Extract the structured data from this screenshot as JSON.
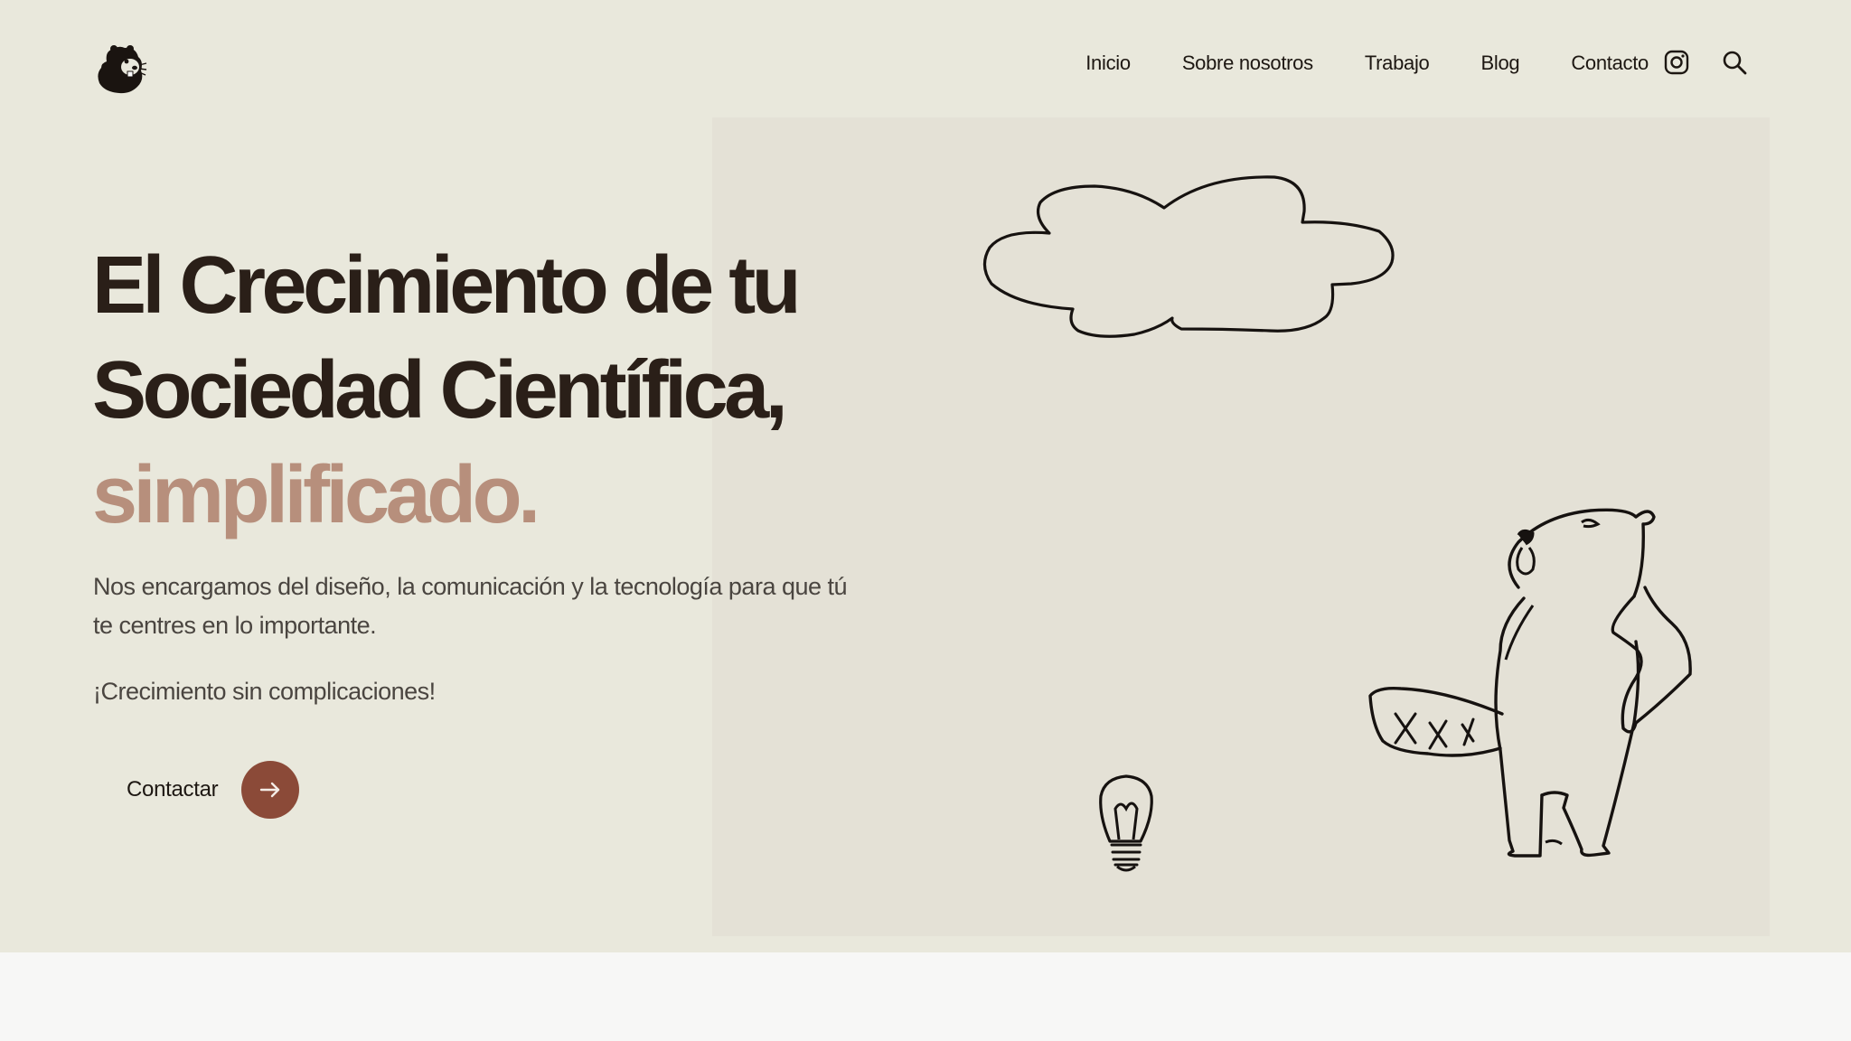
{
  "nav": {
    "items": [
      {
        "label": "Inicio"
      },
      {
        "label": "Sobre nosotros"
      },
      {
        "label": "Trabajo"
      },
      {
        "label": "Blog"
      },
      {
        "label": "Contacto"
      }
    ],
    "icons": [
      "instagram-icon",
      "search-icon"
    ]
  },
  "hero": {
    "headline_line1": "El Crecimiento de tu",
    "headline_line2": "Sociedad Científica,",
    "headline_accent": "simplificado.",
    "subtitle": "Nos encargamos del diseño, la comunicación y la tecnología para que tú te centres en lo importante.",
    "tagline": "¡Crecimiento sin complicaciones!",
    "cta_label": "Contactar",
    "cta_icon": "arrow-right-icon"
  },
  "colors": {
    "hero_background": "#e9e8dc",
    "panel_background": "#e4e1d6",
    "accent_text": "#b78f7c",
    "cta_button": "#8b4a38",
    "headline_text": "#2a1f18"
  },
  "illustration": {
    "elements": [
      "cloud",
      "lightbulb",
      "beaver"
    ]
  }
}
